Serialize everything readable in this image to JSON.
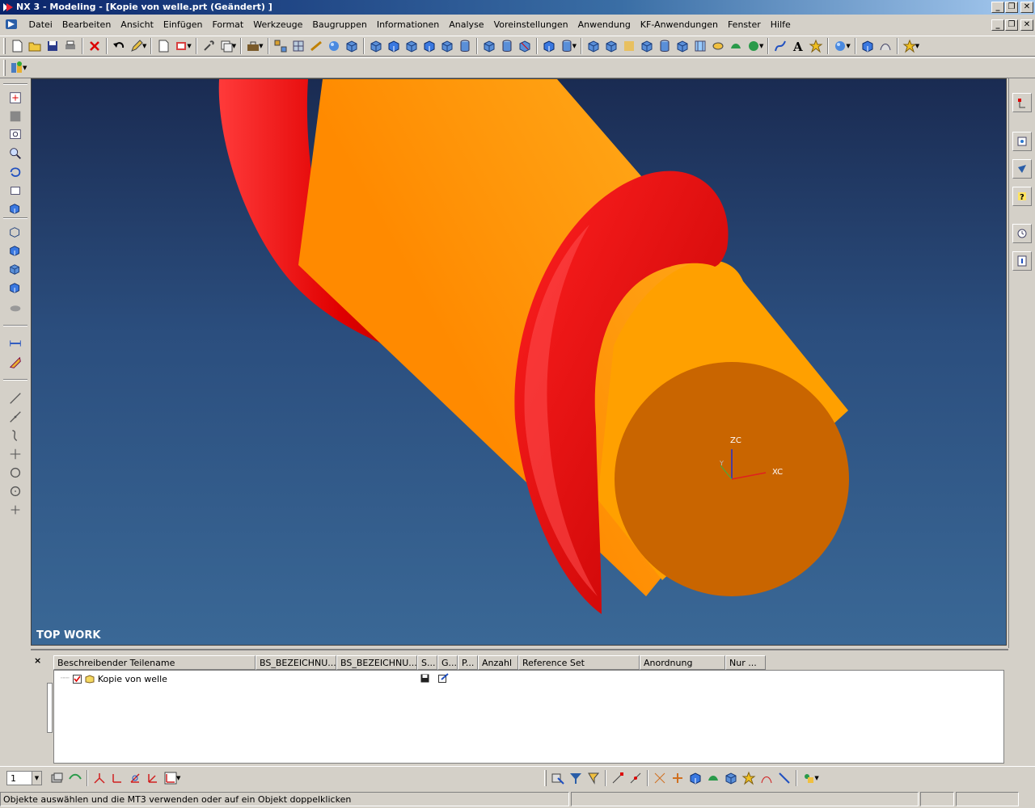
{
  "window": {
    "title": "NX 3 - Modeling - [Kopie von welle.prt (Geändert) ]",
    "min": "_",
    "restore": "❐",
    "close": "✕"
  },
  "menu": [
    "Datei",
    "Bearbeiten",
    "Ansicht",
    "Einfügen",
    "Format",
    "Werkzeuge",
    "Baugruppen",
    "Informationen",
    "Analyse",
    "Voreinstellungen",
    "Anwendung",
    "KF-Anwendungen",
    "Fenster",
    "Hilfe"
  ],
  "viewport": {
    "label": "TOP WORK",
    "axes": {
      "z": "ZC",
      "x": "XC",
      "y": "Y"
    },
    "colors": {
      "shaft": "#ff9a00",
      "shaft_face": "#c86400",
      "helix": "#e00000",
      "bg_top": "#1a2b52",
      "bg_bottom": "#3a6896"
    }
  },
  "navigator": {
    "close": "×",
    "columns": [
      "Beschreibender Teilename",
      "BS_BEZEICHNU...",
      "BS_BEZEICHNU...",
      "S...",
      "G...",
      "P...",
      "Anzahl",
      "Reference Set",
      "Anordnung",
      "Nur ..."
    ],
    "rows": [
      {
        "name": "Kopie von welle",
        "checked": true
      }
    ]
  },
  "bottom": {
    "layer_value": "1"
  },
  "status": {
    "message": "Objekte auswählen und die MT3 verwenden oder auf ein Objekt doppelklicken"
  }
}
